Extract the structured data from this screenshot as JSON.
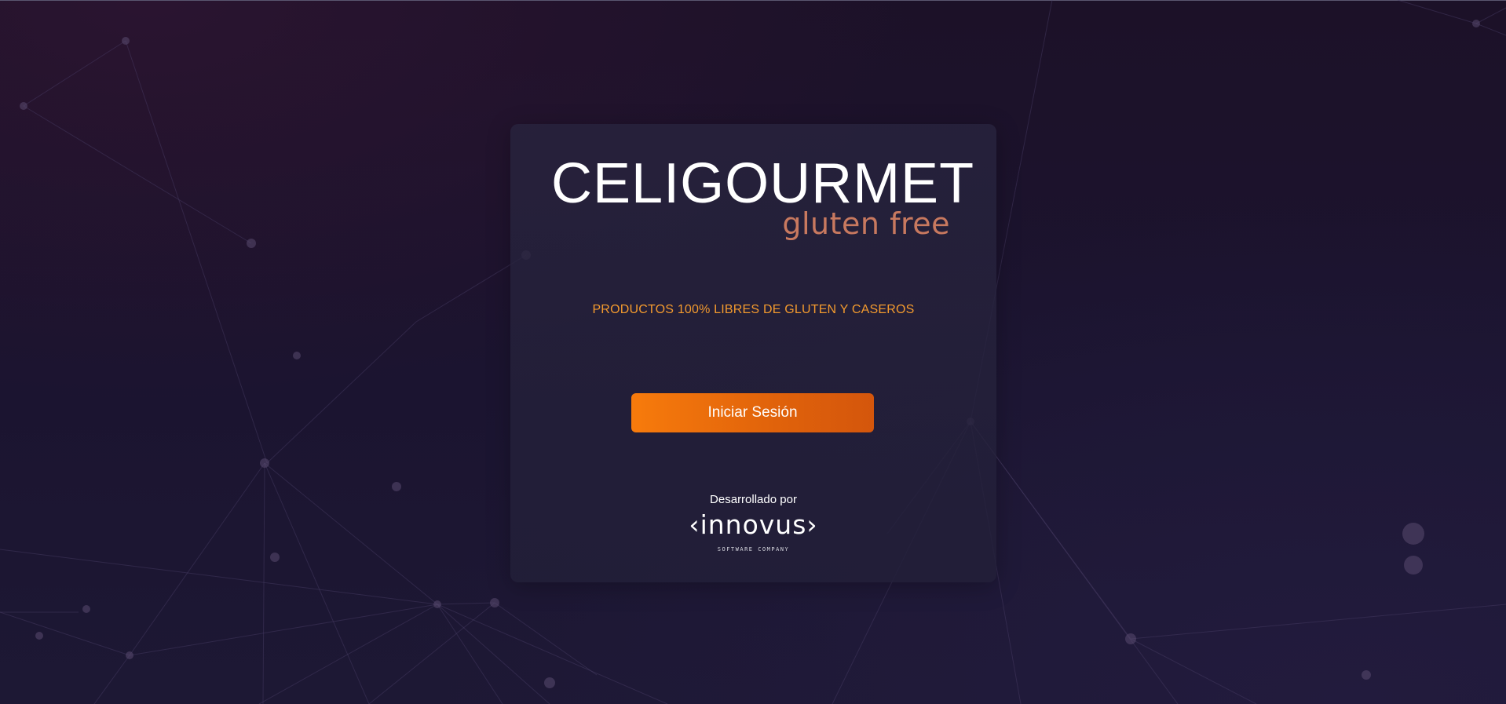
{
  "brand": {
    "logo_main": "CELIGOURMET",
    "logo_sub": "gluten free",
    "logo_sub_color": "#c8795f"
  },
  "tagline": "PRODUCTOS 100% LIBRES DE GLUTEN Y CASEROS",
  "login_button": {
    "label": "Iniciar Sesión",
    "color": "#f77b0c"
  },
  "footer": {
    "developed_by": "Desarrollado por",
    "company_name": "‹innovus›",
    "company_tagline": "SOFTWARE COMPANY"
  },
  "colors": {
    "background": "#1b1430",
    "card": "#26223c",
    "accent": "#f39a2e"
  }
}
